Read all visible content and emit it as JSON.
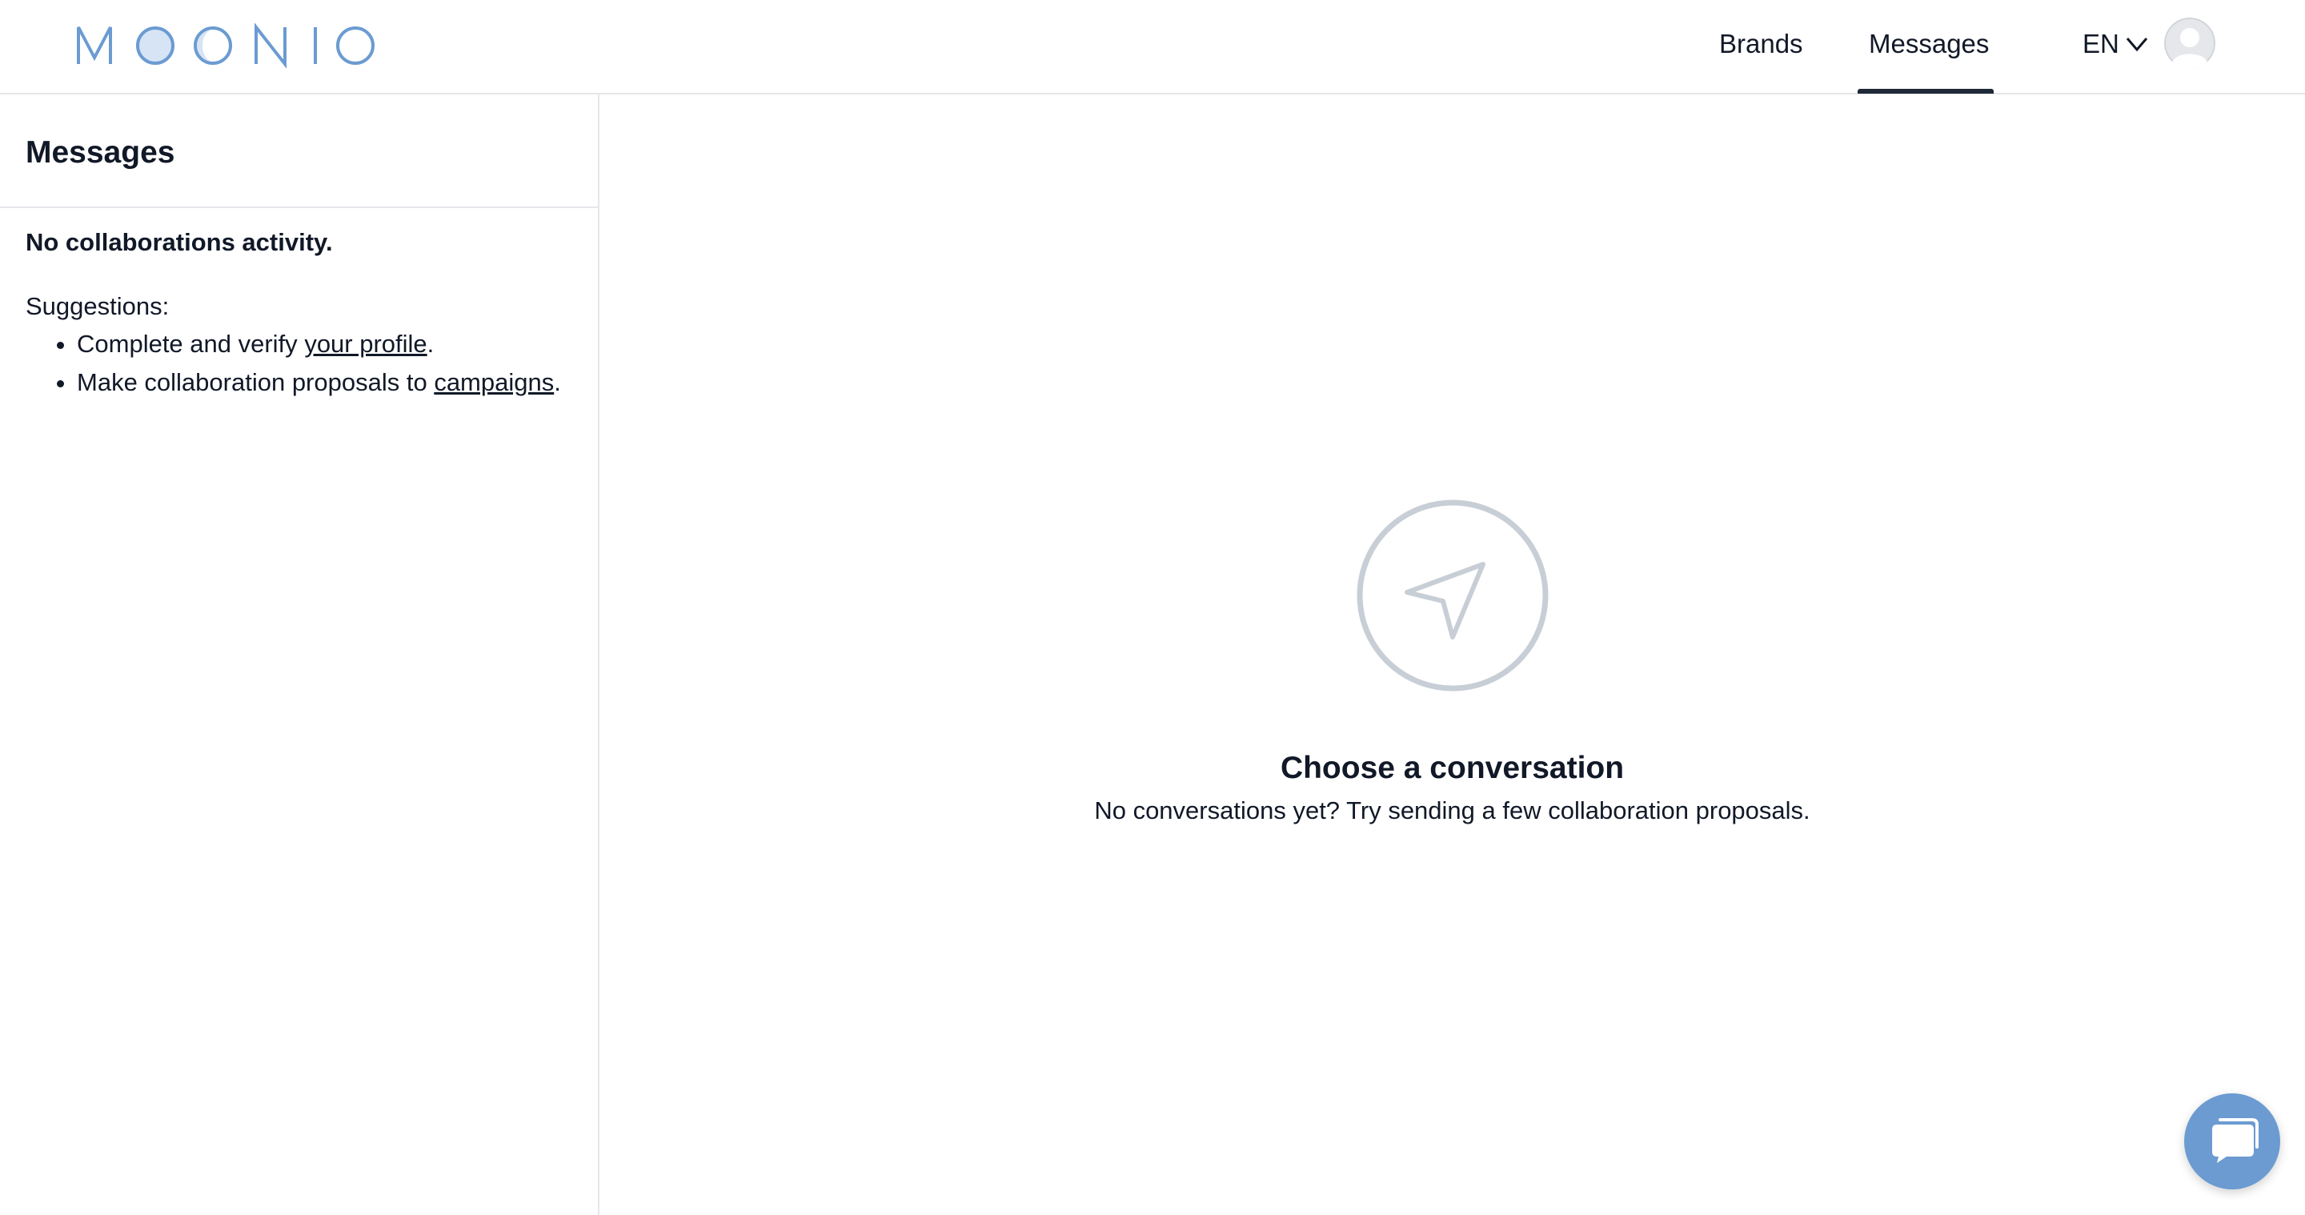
{
  "header": {
    "logo_text": "MOONIO",
    "nav": [
      {
        "label": "Brands"
      },
      {
        "label": "Messages",
        "active": true
      }
    ],
    "language": "EN",
    "colors": {
      "logo_blue": "#6b9bd1",
      "active_underline": "#1f2937"
    }
  },
  "sidebar": {
    "title": "Messages",
    "empty_state": "No collaborations activity.",
    "suggestions_label": "Suggestions:",
    "suggestions": [
      {
        "before": "Complete and verify ",
        "link": "your profile",
        "after": "."
      },
      {
        "before": "Make collaboration proposals to ",
        "link": "campaigns",
        "after": "."
      }
    ]
  },
  "main": {
    "icon": "send-icon",
    "title": "Choose a conversation",
    "subtitle": "No conversations yet? Try sending a few collaboration proposals."
  },
  "chat_widget": {
    "icon": "chat-bubble-icon",
    "color": "#6b9bd1"
  }
}
